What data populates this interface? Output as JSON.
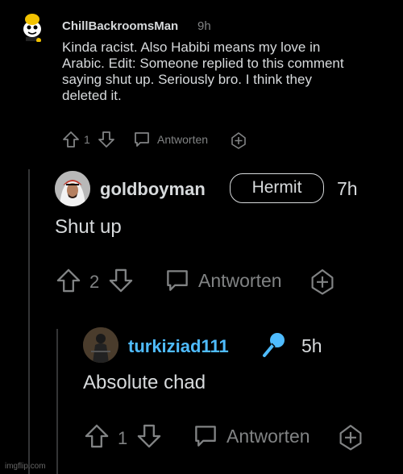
{
  "comments": [
    {
      "username": "ChillBackroomsMan",
      "time": "9h",
      "text_lines": [
        "Kinda racist. Also Habibi means my love in",
        "Arabic. Edit: Someone replied to this comment",
        "saying shut up. Seriously bro. I think they",
        "deleted it."
      ],
      "votes": "1",
      "reply_label": "Antworten"
    },
    {
      "username": "goldboyman",
      "flair": "Hermit",
      "time": "7h",
      "text": "Shut up",
      "votes": "2",
      "reply_label": "Antworten"
    },
    {
      "username": "turkiziad111",
      "time": "5h",
      "text": "Absolute chad",
      "votes": "1",
      "reply_label": "Antworten"
    }
  ],
  "watermark": "imgflip.com",
  "colors": {
    "background": "#000000",
    "text": "#d7dadc",
    "muted": "#818384",
    "username_blue": "#4fbcff",
    "thread_line": "#343536"
  }
}
